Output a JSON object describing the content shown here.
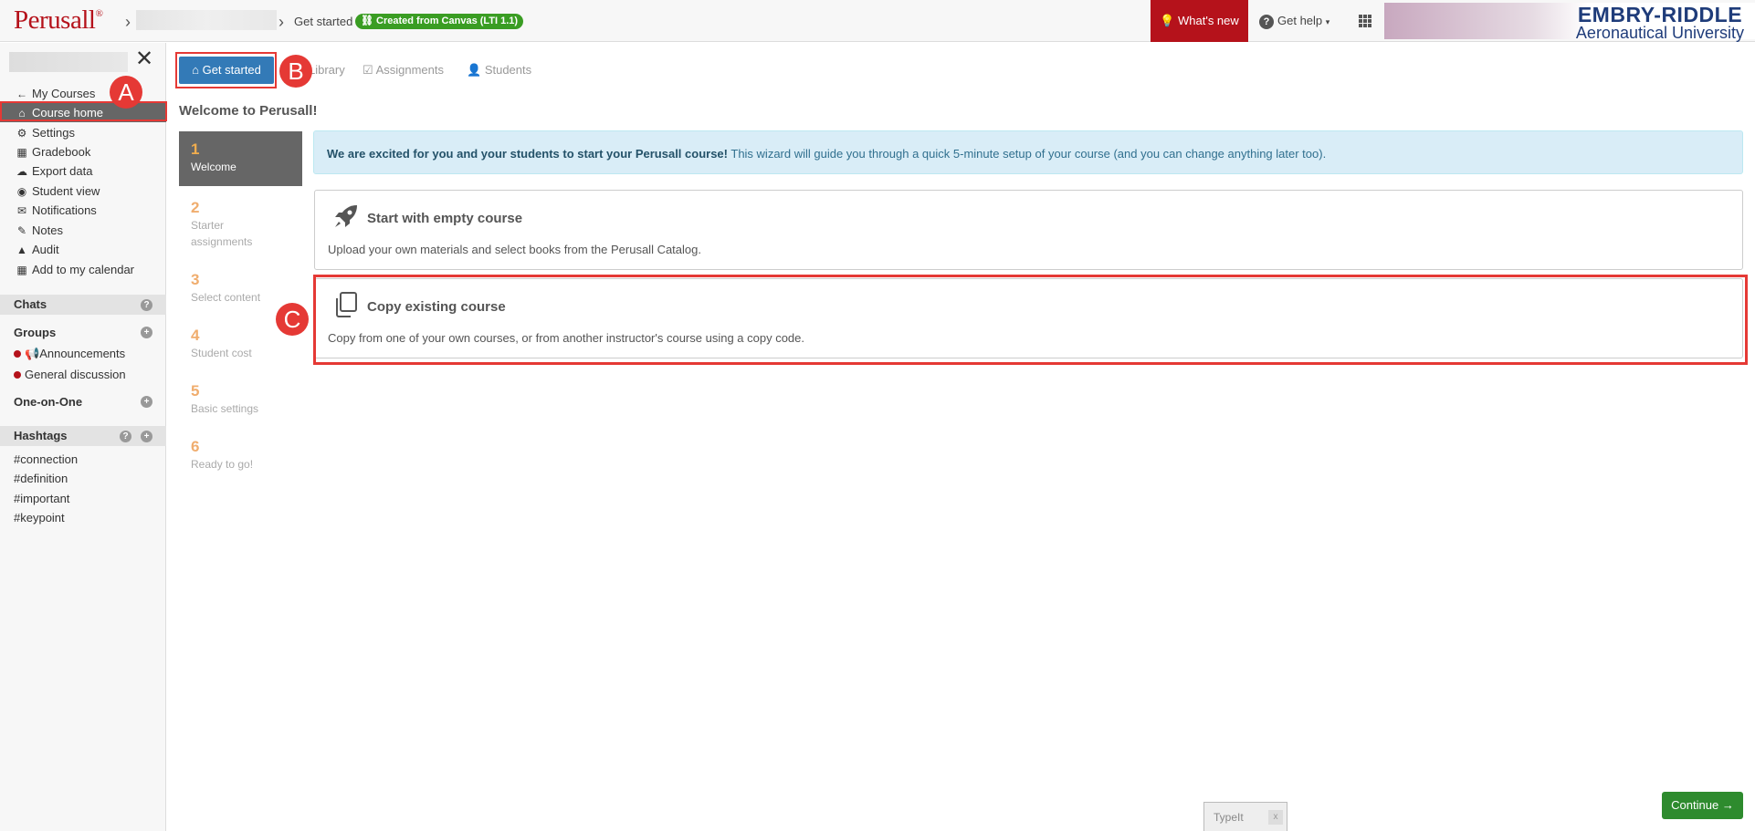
{
  "header": {
    "logo": "Perusall",
    "logo_mark": "®",
    "crumb_current": "Get started",
    "lti_badge": "Created from Canvas (LTI 1.1)",
    "whats_new": "What's new",
    "get_help": "Get help",
    "help_icon_glyph": "?",
    "institution_line1": "EMBRY-RIDDLE",
    "institution_line2": "Aeronautical University"
  },
  "sidebar": {
    "close_glyph": "✕",
    "nav": [
      {
        "label": "My Courses",
        "icon": "arrow-left-icon",
        "glyph": "←"
      },
      {
        "label": "Course home",
        "icon": "home-icon",
        "glyph": "⌂"
      },
      {
        "label": "Settings",
        "icon": "gear-icon",
        "glyph": "⚙"
      },
      {
        "label": "Gradebook",
        "icon": "table-icon",
        "glyph": "▦"
      },
      {
        "label": "Export data",
        "icon": "cloud-download-icon",
        "glyph": "☁"
      },
      {
        "label": "Student view",
        "icon": "eye-icon",
        "glyph": "◉"
      },
      {
        "label": "Notifications",
        "icon": "inbox-icon",
        "glyph": "✉"
      },
      {
        "label": "Notes",
        "icon": "pencil-icon",
        "glyph": "✎"
      },
      {
        "label": "Audit",
        "icon": "warning-icon",
        "glyph": "▲"
      },
      {
        "label": "Add to my calendar",
        "icon": "calendar-icon",
        "glyph": "▦"
      }
    ],
    "chats_label": "Chats",
    "groups_label": "Groups",
    "channels": [
      "Announcements",
      "General discussion"
    ],
    "one_on_one_label": "One-on-One",
    "hashtags_label": "Hashtags",
    "hashtags": [
      "#connection",
      "#definition",
      "#important",
      "#keypoint"
    ],
    "help_glyph": "?",
    "plus_glyph": "+"
  },
  "tabs": {
    "get_started": "Get started",
    "library": "Library",
    "assignments": "Assignments",
    "students": "Students"
  },
  "welcome_title": "Welcome to Perusall!",
  "steps": [
    {
      "num": "1",
      "label": "Welcome"
    },
    {
      "num": "2",
      "label": "Starter assignments"
    },
    {
      "num": "3",
      "label": "Select content"
    },
    {
      "num": "4",
      "label": "Student cost"
    },
    {
      "num": "5",
      "label": "Basic settings"
    },
    {
      "num": "6",
      "label": "Ready to go!"
    }
  ],
  "info": {
    "bold": "We are excited for you and your students to start your Perusall course!",
    "rest": " This wizard will guide you through a quick 5-minute setup of your course (and you can change anything later too)."
  },
  "options": [
    {
      "title": "Start with empty course",
      "desc": "Upload your own materials and select books from the Perusall Catalog.",
      "icon": "rocket-icon"
    },
    {
      "title": "Copy existing course",
      "desc": "Copy from one of your own courses, or from another instructor's course using a copy code.",
      "icon": "copy-icon"
    }
  ],
  "markers": {
    "a": "A",
    "b": "B",
    "c": "C"
  },
  "continue_label": "Continue",
  "continue_glyph": "→",
  "typeit": {
    "label": "TypeIt",
    "close": "x"
  },
  "colors": {
    "brand": "#b5121b",
    "primary": "#337ab7",
    "success": "#2e8b2e",
    "annotation": "#e53935"
  }
}
